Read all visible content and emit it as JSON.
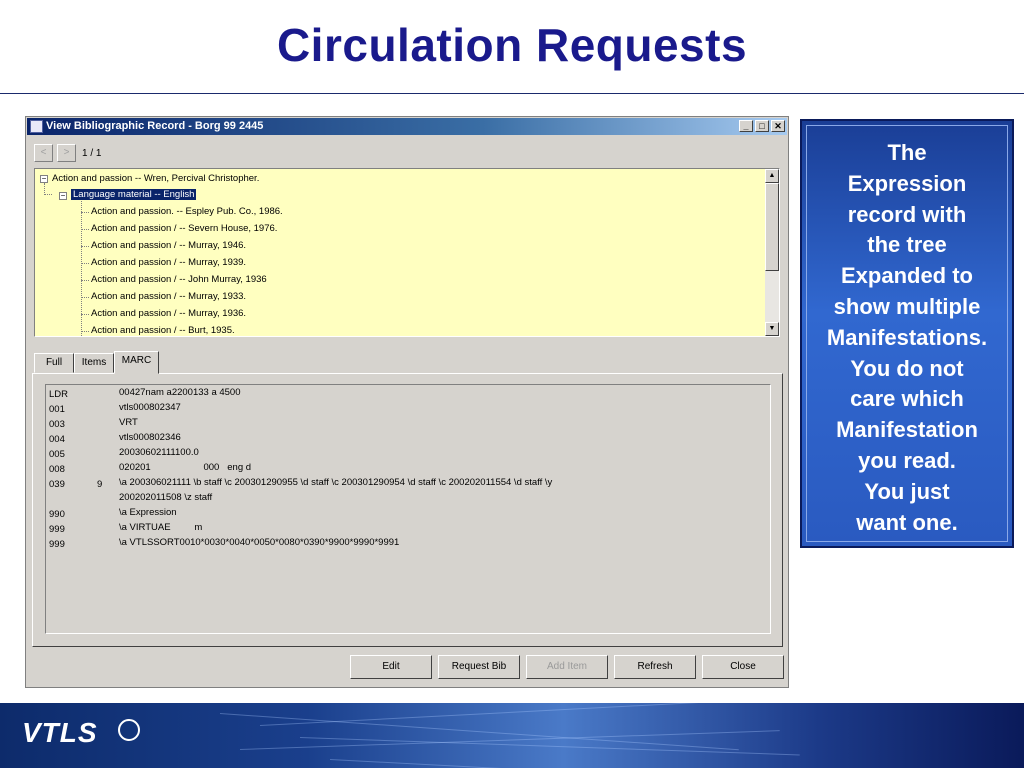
{
  "slide": {
    "title": "Circulation Requests",
    "note_lines": [
      "The",
      "Expression",
      "record with",
      "the tree",
      "Expanded to",
      "show multiple",
      "Manifestations.",
      "You do not",
      "care which",
      "Manifestation",
      "you read.",
      "You just",
      "want one."
    ],
    "logo_text": "VTLS"
  },
  "window": {
    "title": "View Bibliographic Record - Borg 99 2445",
    "controls": {
      "minimize": "_",
      "maximize": "□",
      "close": "✕"
    },
    "nav": {
      "prev": "<",
      "next": ">",
      "pager": "1 / 1"
    },
    "tree": {
      "root": "Action and passion -- Wren, Percival Christopher.",
      "child": "Language material -- English",
      "leaves": [
        "Action and passion. -- Espley Pub. Co., 1986.",
        "Action and passion / -- Severn House, 1976.",
        "Action and passion / -- Murray, 1946.",
        "Action and passion / -- Murray, 1939.",
        "Action and passion / -- John Murray, 1936",
        "Action and passion / -- Murray, 1933.",
        "Action and passion / -- Murray, 1936.",
        "Action and passion / -- Burt, 1935."
      ]
    },
    "tabs": [
      "Full",
      "Items",
      "MARC"
    ],
    "active_tab": "MARC",
    "marc": [
      {
        "tag": "LDR",
        "ind": "",
        "value": "00427nam a2200133 a 4500"
      },
      {
        "tag": "001",
        "ind": "",
        "value": "vtls000802347"
      },
      {
        "tag": "003",
        "ind": "",
        "value": "VRT"
      },
      {
        "tag": "004",
        "ind": "",
        "value": "vtls000802346"
      },
      {
        "tag": "005",
        "ind": "",
        "value": "20030602111100.0"
      },
      {
        "tag": "008",
        "ind": "",
        "value": "020201                    000   eng d"
      },
      {
        "tag": "039",
        "ind": "9",
        "value": "\\a 200306021111 \\b staff \\c 200301290955 \\d staff \\c 200301290954 \\d staff \\c 200202011554 \\d staff \\y"
      },
      {
        "tag": "",
        "ind": "",
        "value": "200202011508 \\z staff"
      },
      {
        "tag": "990",
        "ind": "",
        "value": "\\a Expression"
      },
      {
        "tag": "999",
        "ind": "",
        "value": "\\a VIRTUAE         m"
      },
      {
        "tag": "999",
        "ind": "",
        "value": "\\a VTLSSORT0010*0030*0040*0050*0080*0390*9900*9990*9991"
      }
    ],
    "buttons": {
      "edit": "Edit",
      "request_bib": "Request Bib",
      "add_item": "Add Item",
      "refresh": "Refresh",
      "close": "Close"
    }
  }
}
